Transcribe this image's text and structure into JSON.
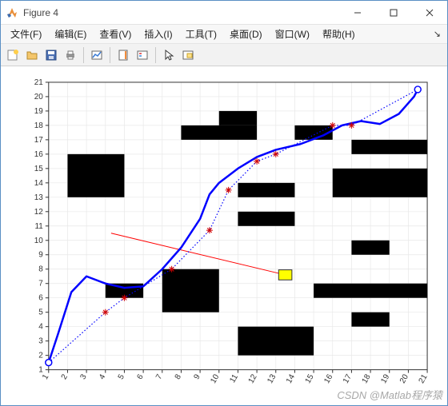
{
  "window": {
    "title": "Figure 4",
    "icon_name": "matlab-icon"
  },
  "window_buttons": {
    "min": "minimize-icon",
    "max": "maximize-icon",
    "close": "close-icon"
  },
  "menubar": [
    {
      "key": "file",
      "label": "文件(F)"
    },
    {
      "key": "edit",
      "label": "编辑(E)"
    },
    {
      "key": "view",
      "label": "查看(V)"
    },
    {
      "key": "insert",
      "label": "插入(I)"
    },
    {
      "key": "tools",
      "label": "工具(T)"
    },
    {
      "key": "desktop",
      "label": "桌面(D)"
    },
    {
      "key": "window_menu",
      "label": "窗口(W)"
    },
    {
      "key": "help",
      "label": "帮助(H)"
    }
  ],
  "menubar_overflow": "↘",
  "toolbar_icons": [
    {
      "name": "new-figure-icon",
      "group": 0
    },
    {
      "name": "open-icon",
      "group": 0
    },
    {
      "name": "save-icon",
      "group": 0
    },
    {
      "name": "print-icon",
      "group": 0
    },
    {
      "name": "link-plot-icon",
      "group": 1
    },
    {
      "name": "insert-colorbar-icon",
      "group": 2
    },
    {
      "name": "insert-legend-icon",
      "group": 2
    },
    {
      "name": "pointer-icon",
      "group": 3
    },
    {
      "name": "brush-icon",
      "group": 3
    }
  ],
  "watermark": "CSDN @Matlab程序猿",
  "chart_data": {
    "type": "line",
    "xlabel": "",
    "ylabel": "",
    "xlim": [
      1,
      21
    ],
    "ylim": [
      1,
      21
    ],
    "xticks": [
      1,
      2,
      3,
      4,
      5,
      6,
      7,
      8,
      9,
      10,
      11,
      12,
      13,
      14,
      15,
      16,
      17,
      18,
      19,
      20,
      21
    ],
    "yticks": [
      1,
      2,
      3,
      4,
      5,
      6,
      7,
      8,
      9,
      10,
      11,
      12,
      13,
      14,
      15,
      16,
      17,
      18,
      19,
      20,
      21
    ],
    "grid": true,
    "obstacles": [
      {
        "x": 2,
        "y": 13,
        "w": 3,
        "h": 3
      },
      {
        "x": 8,
        "y": 17,
        "w": 4,
        "h": 1
      },
      {
        "x": 10,
        "y": 18,
        "w": 2,
        "h": 1
      },
      {
        "x": 14,
        "y": 17,
        "w": 2,
        "h": 1
      },
      {
        "x": 17,
        "y": 16,
        "w": 4,
        "h": 1
      },
      {
        "x": 16,
        "y": 13,
        "w": 5,
        "h": 2
      },
      {
        "x": 11,
        "y": 13,
        "w": 3,
        "h": 1
      },
      {
        "x": 11,
        "y": 11,
        "w": 3,
        "h": 1
      },
      {
        "x": 4,
        "y": 6,
        "w": 2,
        "h": 1
      },
      {
        "x": 7,
        "y": 5,
        "w": 3,
        "h": 3
      },
      {
        "x": 11,
        "y": 2,
        "w": 4,
        "h": 2
      },
      {
        "x": 15,
        "y": 6,
        "w": 6,
        "h": 1
      },
      {
        "x": 17,
        "y": 4,
        "w": 2,
        "h": 1
      },
      {
        "x": 17,
        "y": 9,
        "w": 2,
        "h": 1
      }
    ],
    "series": [
      {
        "name": "waypoints",
        "style": "dotted",
        "color": "#0000ff",
        "marker": "*",
        "marker_color": "#d00000",
        "points": [
          [
            1,
            1.5
          ],
          [
            4,
            5
          ],
          [
            5,
            6
          ],
          [
            7.5,
            8
          ],
          [
            9.5,
            10.7
          ],
          [
            10.5,
            13.5
          ],
          [
            12,
            15.5
          ],
          [
            13,
            16
          ],
          [
            16,
            18
          ],
          [
            17,
            18
          ],
          [
            20.5,
            20.5
          ]
        ]
      },
      {
        "name": "smooth-path",
        "style": "solid",
        "color": "#0000ff",
        "width": 2.5,
        "points": [
          [
            1,
            1.5
          ],
          [
            1.5,
            3.5
          ],
          [
            2.2,
            6.4
          ],
          [
            3,
            7.5
          ],
          [
            4,
            7
          ],
          [
            5,
            6.7
          ],
          [
            6,
            6.8
          ],
          [
            7,
            8
          ],
          [
            8,
            9.5
          ],
          [
            9,
            11.5
          ],
          [
            9.5,
            13.2
          ],
          [
            10,
            14
          ],
          [
            11,
            15
          ],
          [
            12,
            15.8
          ],
          [
            13,
            16.3
          ],
          [
            14.3,
            16.7
          ],
          [
            15.5,
            17.3
          ],
          [
            16.5,
            18
          ],
          [
            17.5,
            18.3
          ],
          [
            18.5,
            18.1
          ],
          [
            19.5,
            18.8
          ],
          [
            20.3,
            20
          ],
          [
            20.5,
            20.5
          ]
        ]
      },
      {
        "name": "red-line",
        "style": "solid",
        "color": "#ff0000",
        "width": 1,
        "points": [
          [
            4.3,
            10.5
          ],
          [
            13.5,
            7.6
          ]
        ]
      }
    ],
    "markers": {
      "start_circle": {
        "x": 1,
        "y": 1.5,
        "color": "#0000ff"
      },
      "goal_circle": {
        "x": 20.5,
        "y": 20.5,
        "color": "#0000ff"
      },
      "yellow_square": {
        "x": 13.5,
        "y": 7.6,
        "size": 0.7,
        "fill": "#ffff00",
        "stroke": "#333"
      }
    }
  }
}
